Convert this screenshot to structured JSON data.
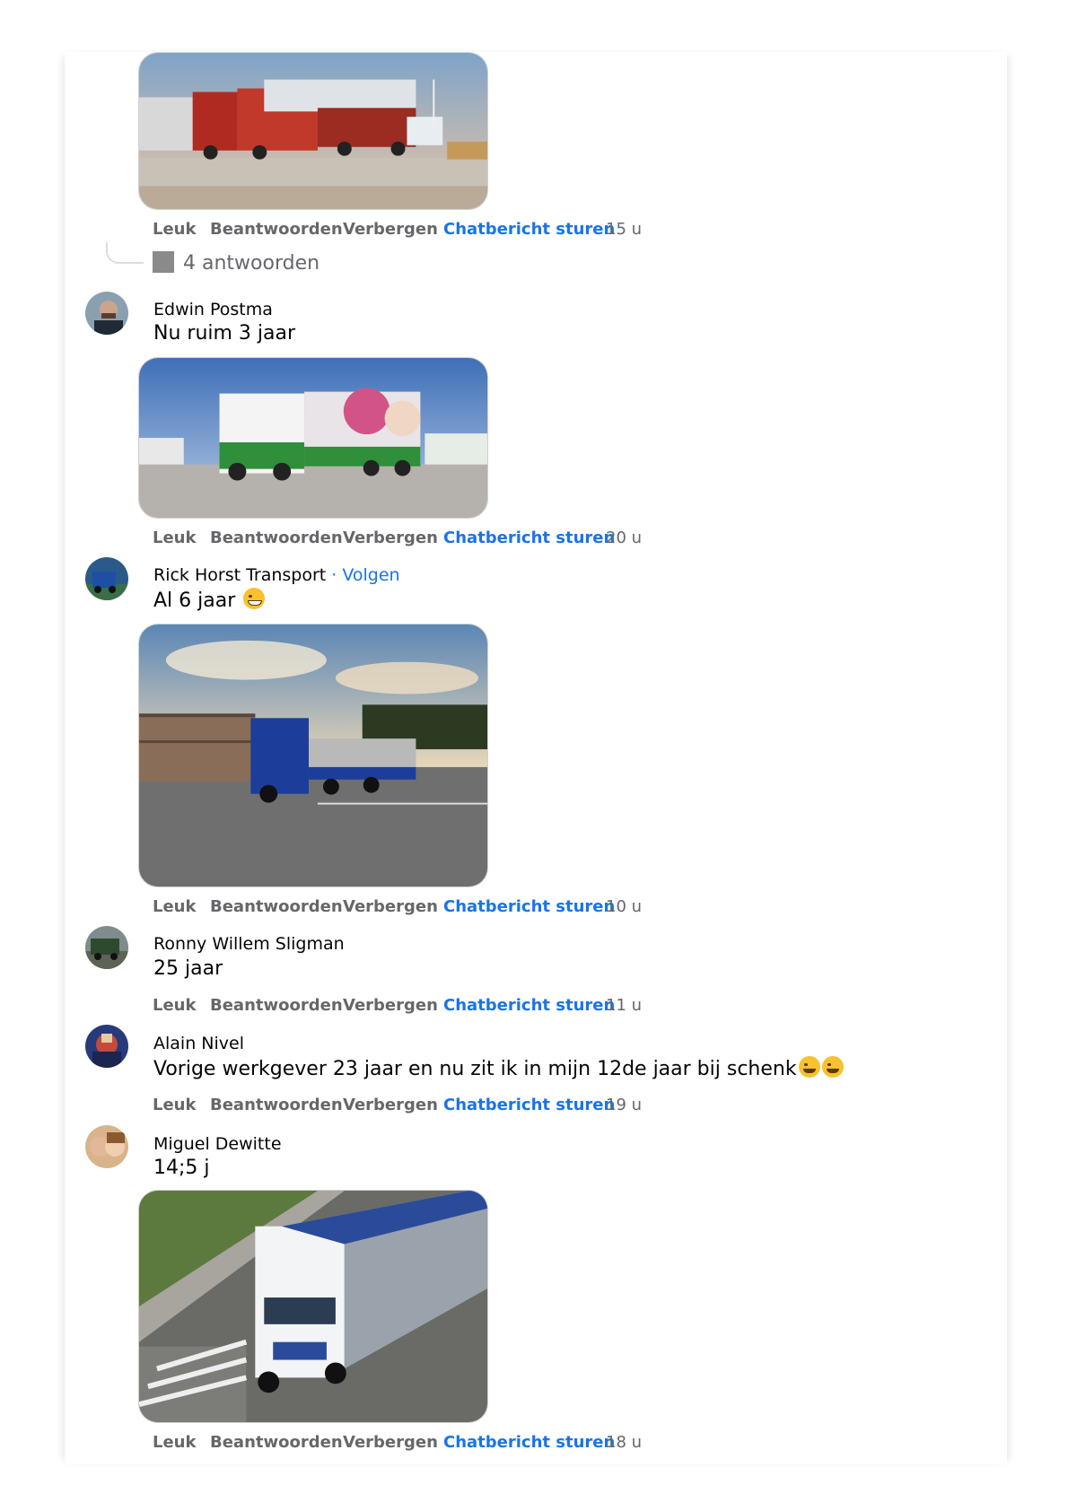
{
  "actions": {
    "like": "Leuk",
    "reply": "Beantwoorden",
    "hide": "Verbergen",
    "message": "Chatbericht sturen"
  },
  "replies_link": "4 antwoorden",
  "comments": [
    {
      "time": "15 u",
      "image": "trucks-red"
    },
    {
      "author": "Edwin Postma",
      "text": "Nu ruim 3 jaar",
      "time": "20 u",
      "image": "truck-green"
    },
    {
      "author": "Rick Horst Transport",
      "follow": "· Volgen",
      "text": "Al 6 jaar",
      "emoji": "grin-emoji",
      "time": "10 u",
      "image": "truck-blue"
    },
    {
      "author": "Ronny Willem Sligman",
      "text": "25 jaar",
      "time": "11 u"
    },
    {
      "author": "Alain Nivel",
      "text": "Vorige werkgever 23 jaar en nu zit ik in mijn 12de jaar bij schenk",
      "emoji": "wink-emoji",
      "time": "19 u"
    },
    {
      "author": "Miguel Dewitte",
      "text": "14;5 j",
      "time": "18 u",
      "image": "truck-white"
    }
  ],
  "colors": {
    "link": "#1b74e4",
    "muted": "#65676b",
    "text": "#050505"
  }
}
